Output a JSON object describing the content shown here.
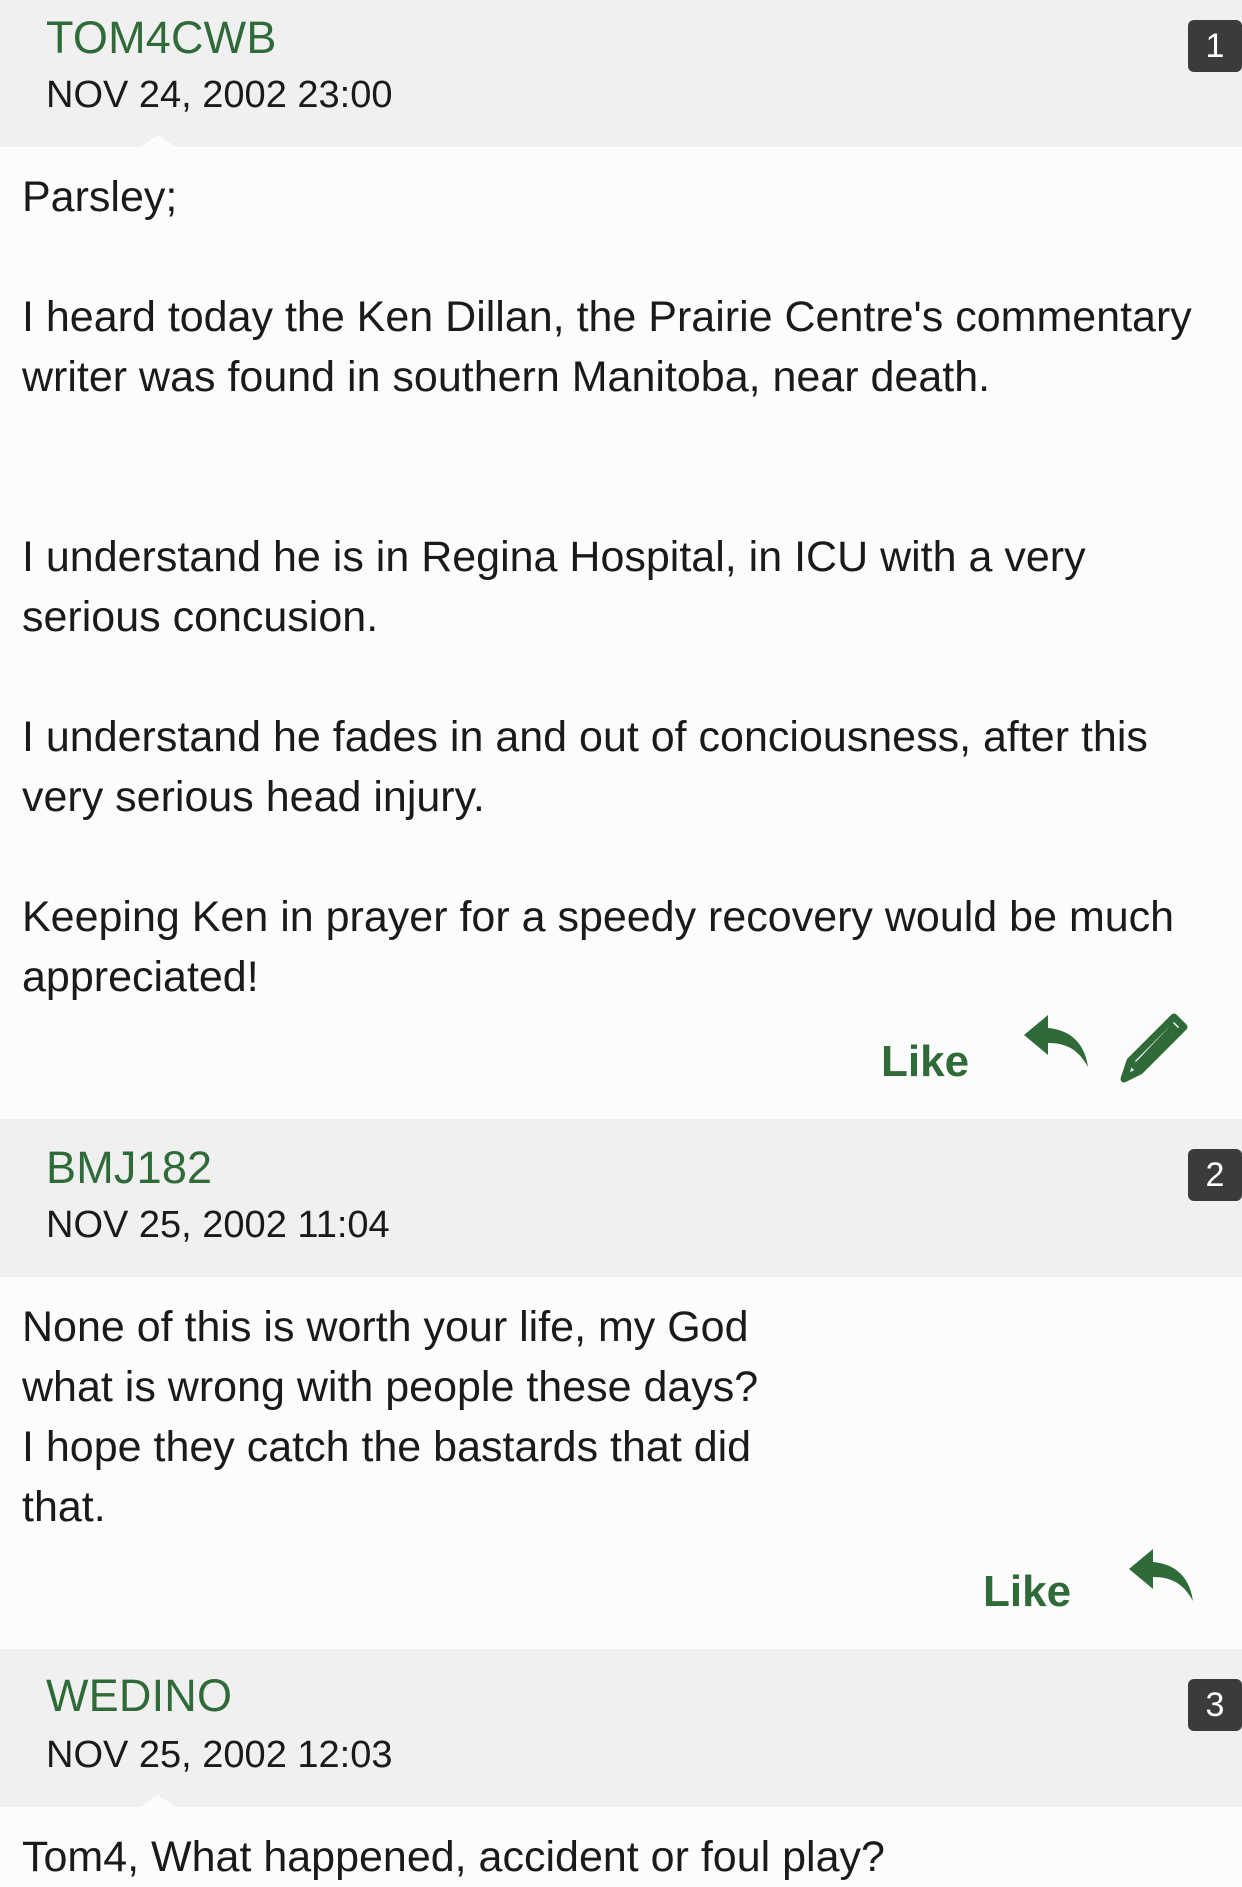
{
  "colors": {
    "accent_green": "#2f6b38",
    "header_bg": "#f0f0f0",
    "body_bg": "#fcfcfc",
    "badge_bg": "#3b3b3b"
  },
  "posts": [
    {
      "username": "TOM4CWB",
      "timestamp": "NOV 24, 2002 23:00",
      "number": "1",
      "paragraphs": [
        "Parsley;",
        "I heard today the Ken Dillan, the Prairie Centre's commentary writer was found in southern Manitoba, near death.",
        "I understand he is in Regina Hospital, in ICU with a very serious concusion.",
        "I understand he fades in and out of conciousness, after this very serious head injury.",
        "Keeping Ken in prayer for a speedy recovery would be much appreciated!"
      ],
      "like_label": "Like",
      "icons": [
        "reply-icon",
        "edit-pencil-icon"
      ]
    },
    {
      "username": "BMJ182",
      "timestamp": "NOV 25, 2002 11:04",
      "number": "2",
      "paragraphs": [
        "None of this is worth your life, my God what is wrong with people these days? I hope they catch the bastards that did that."
      ],
      "like_label": "Like",
      "icons": [
        "reply-icon"
      ]
    },
    {
      "username": "WEDINO",
      "timestamp": "NOV 25, 2002 12:03",
      "number": "3",
      "paragraphs": [
        "Tom4, What happened, accident or foul play?"
      ]
    }
  ]
}
